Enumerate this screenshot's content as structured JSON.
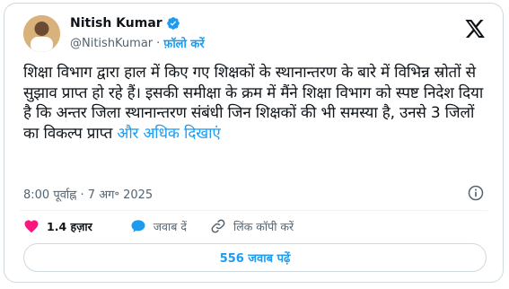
{
  "author": {
    "name": "Nitish Kumar",
    "handle": "@NitishKumar",
    "separator": "·",
    "follow_label": "फ़ॉलो करें",
    "verified_icon": "verified-badge-icon",
    "verified_color": "#1d9bf0"
  },
  "tweet": {
    "text": "शिक्षा विभाग द्वारा हाल में किए गए शिक्षकों के स्थानान्तरण के बारे में विभिन्न स्रोतों से सुझाव प्राप्त हो रहे हैं। इसकी समीक्षा के क्रम में मैंने शिक्षा विभाग को स्पष्ट निदेश दिया है कि अन्तर जिला स्थानान्तरण संबंधी जिन शिक्षकों की भी समस्या है, उनसे 3 जिलों का विकल्प प्राप्त ",
    "show_more": "और अधिक दिखाएं",
    "timestamp": "8:00 पूर्वाह्न · 7 अग॰ 2025"
  },
  "actions": {
    "like_count": "1.4 हज़ार",
    "reply_label": "जवाब दें",
    "copy_link_label": "लिंक कॉपी करें",
    "like_color": "#f91880",
    "accent_color": "#1d9bf0"
  },
  "footer": {
    "read_replies": "556 जवाब पढ़ें"
  },
  "icons": {
    "platform": "x-logo-icon",
    "info": "info-icon",
    "like": "heart-icon",
    "reply": "reply-bubble-icon",
    "link": "link-icon"
  }
}
